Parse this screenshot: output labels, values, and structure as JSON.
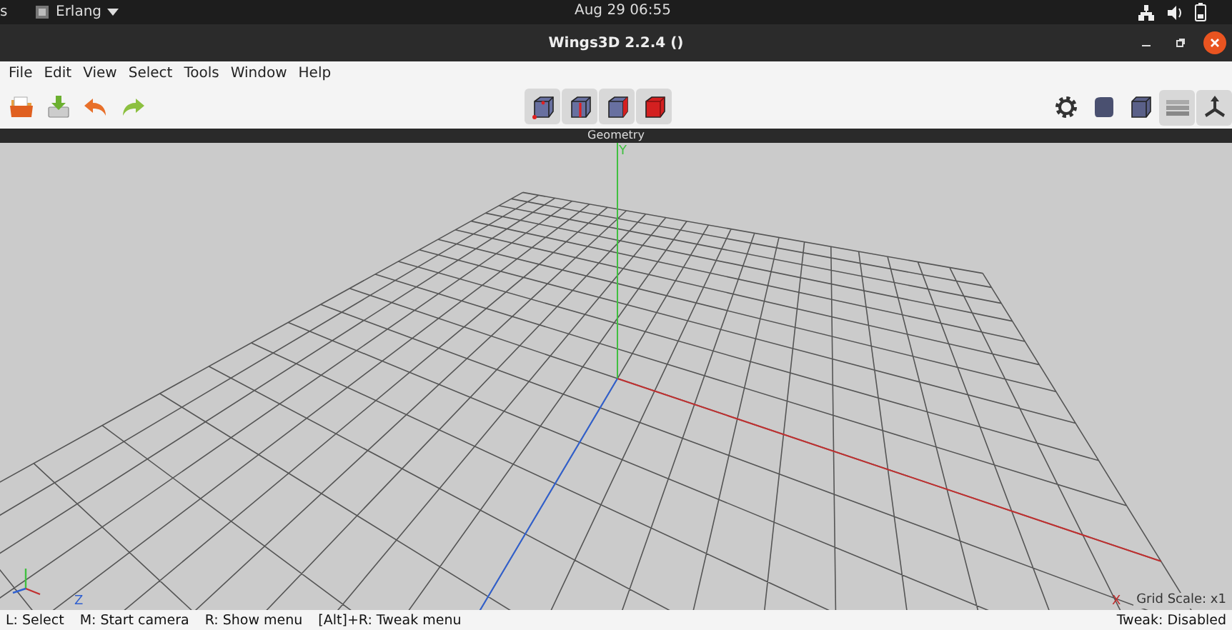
{
  "top_bar": {
    "edge_text": "s",
    "app_menu": "Erlang",
    "clock": "Aug 29  06:55"
  },
  "window": {
    "title": "Wings3D 2.2.4 ()"
  },
  "menu": [
    "File",
    "Edit",
    "View",
    "Select",
    "Tools",
    "Window",
    "Help"
  ],
  "select_modes": [
    {
      "kind": "vertex"
    },
    {
      "kind": "edge"
    },
    {
      "kind": "face"
    },
    {
      "kind": "body"
    }
  ],
  "view_toggles": [
    {
      "kind": "settings",
      "on": false
    },
    {
      "kind": "smooth",
      "on": false
    },
    {
      "kind": "cube",
      "on": false
    },
    {
      "kind": "ground",
      "on": true
    },
    {
      "kind": "axes",
      "on": true
    }
  ],
  "viewport": {
    "header": "Geometry",
    "axis_labels": {
      "y": "Y",
      "z": "Z",
      "x": "X"
    },
    "grid_scale": "Grid Scale: x1"
  },
  "status_bar": {
    "hints": [
      "L: Select",
      "M: Start camera",
      "R: Show menu",
      "[Alt]+R: Tweak menu"
    ],
    "right": "Tweak: Disabled"
  }
}
